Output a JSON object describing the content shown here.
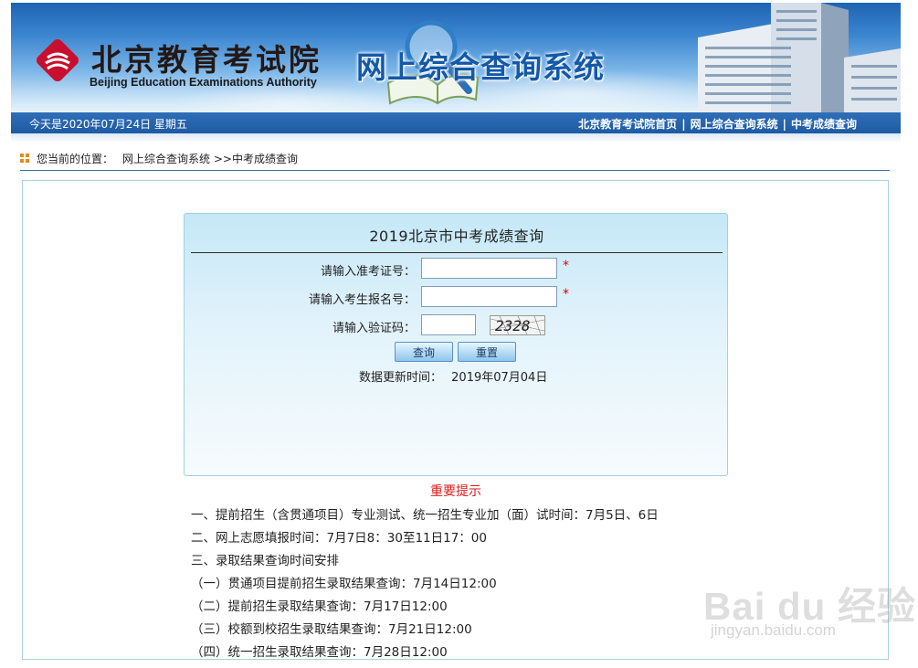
{
  "header": {
    "org_name_cn": "北京教育考试院",
    "org_name_en": "Beijing Education Examinations Authority",
    "system_title": "网上综合查询系统"
  },
  "navbar": {
    "date_text": "今天是2020年07月24日  星期五",
    "links": [
      "北京教育考试院首页",
      "网上综合查询系统",
      "中考成绩查询"
    ],
    "separator": "|"
  },
  "breadcrumb": {
    "prefix": "您当前的位置：",
    "path": "网上综合查询系统 >>中考成绩查询"
  },
  "form": {
    "title": "2019北京市中考成绩查询",
    "exam_id_label": "请输入准考证号：",
    "exam_id_value": "",
    "reg_id_label": "请输入考生报名号：",
    "reg_id_value": "",
    "captcha_label": "请输入验证码：",
    "captcha_value": "",
    "captcha_image_text": "2328",
    "required_mark": "*",
    "query_button": "查询",
    "reset_button": "重置",
    "update_label": "数据更新时间：",
    "update_value": "2019年07月04日"
  },
  "notice": {
    "title": "重要提示",
    "lines": [
      "一、提前招生（含贯通项目）专业测试、统一招生专业加（面）试时间：7月5日、6日",
      "二、网上志愿填报时间：7月7日8：30至11日17：00",
      "三、录取结果查询时间安排",
      "（一）贯通项目提前招生录取结果查询：7月14日12:00",
      "（二）提前招生录取结果查询：7月17日12:00",
      "（三）校额到校招生录取结果查询：7月21日12:00",
      "（四）统一招生录取结果查询：7月28日12:00"
    ]
  },
  "watermark": {
    "brand": "Bai du 经验",
    "url": "jingyan.baidu.com"
  },
  "colors": {
    "navbar": "#1e5aa2",
    "panel_bg": "#c5e8f7",
    "notice_title": "#e01818",
    "required": "#e00000",
    "logo_red": "#c8102e"
  }
}
